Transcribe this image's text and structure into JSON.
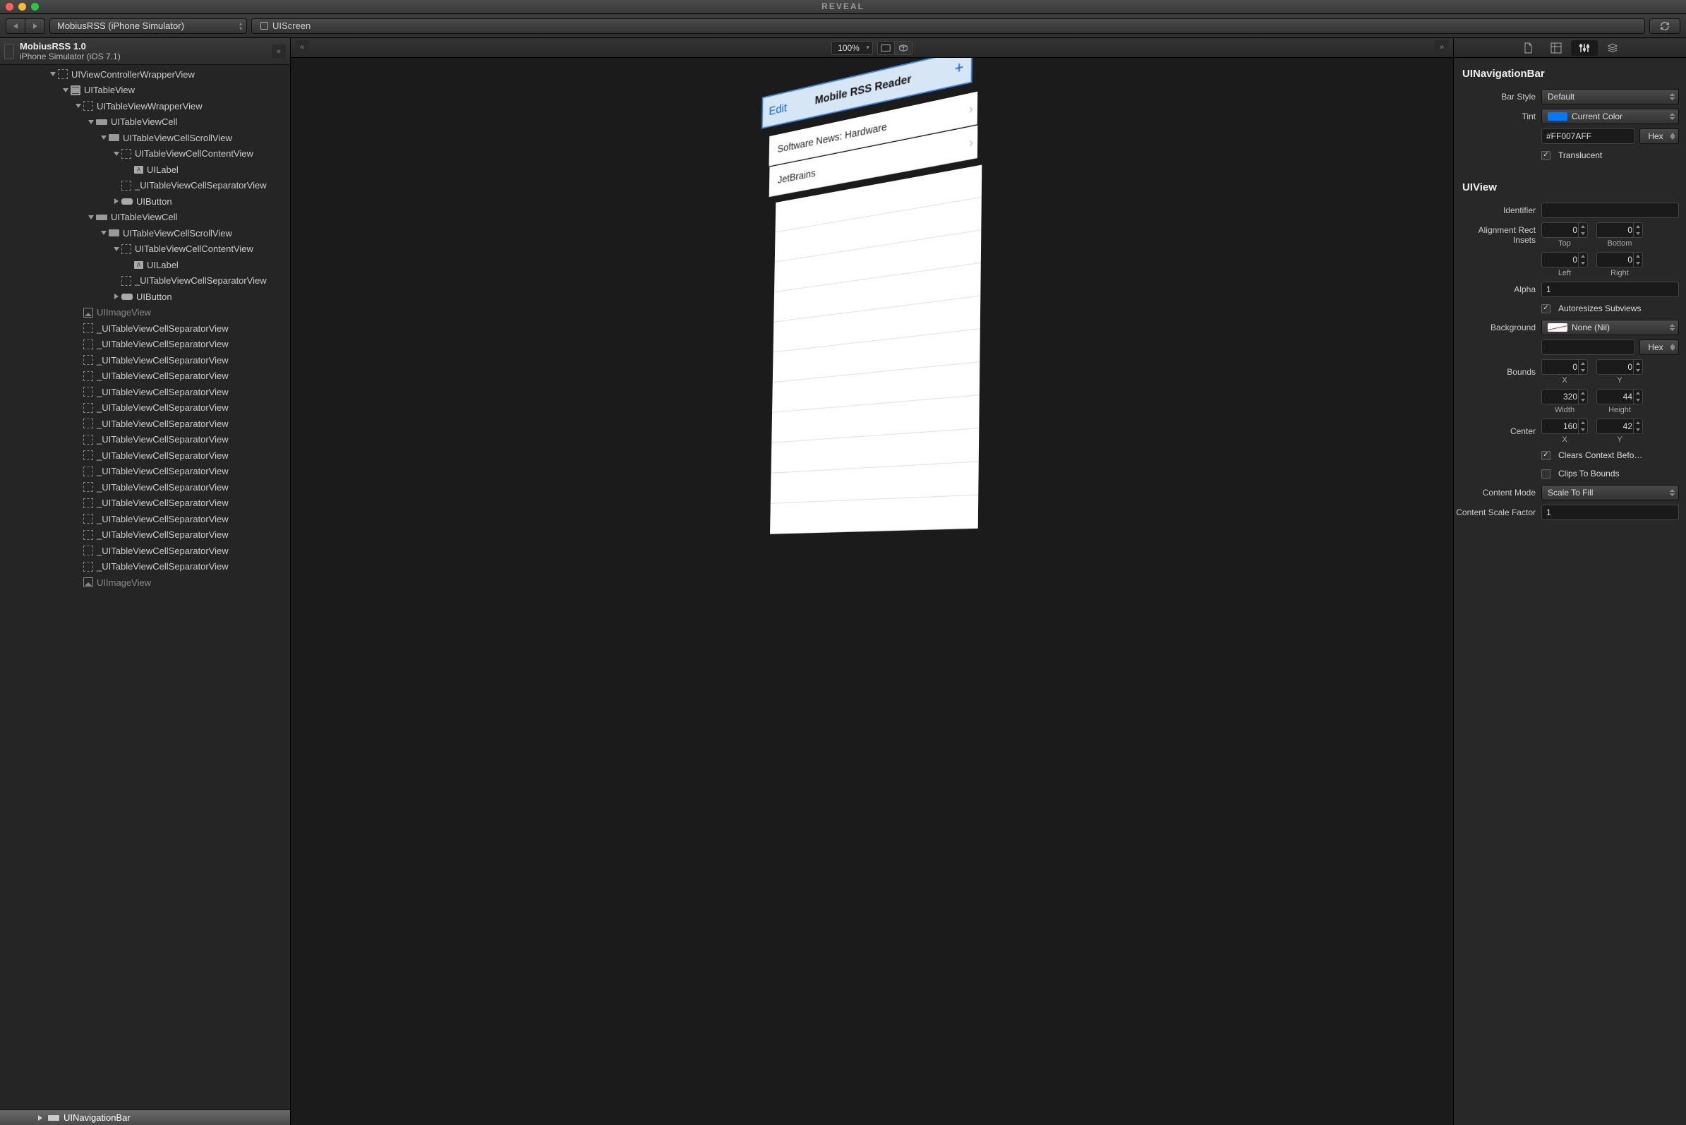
{
  "window": {
    "title": "REVEAL"
  },
  "toolbar": {
    "target_dropdown": "MobiusRSS (iPhone Simulator)",
    "breadcrumb": "UIScreen"
  },
  "sidebar": {
    "header": {
      "app_name": "MobiusRSS 1.0",
      "device": "iPhone Simulator (iOS 7.1)"
    },
    "tree": [
      {
        "depth": 4,
        "disc": "open",
        "icon": "dashed",
        "label": "UIViewControllerWrapperView",
        "dim": false
      },
      {
        "depth": 5,
        "disc": "open",
        "icon": "table",
        "label": "UITableView"
      },
      {
        "depth": 6,
        "disc": "open",
        "icon": "dashed",
        "label": "UITableViewWrapperView"
      },
      {
        "depth": 7,
        "disc": "open",
        "icon": "cell",
        "label": "UITableViewCell"
      },
      {
        "depth": 8,
        "disc": "open",
        "icon": "scroll",
        "label": "UITableViewCellScrollView"
      },
      {
        "depth": 9,
        "disc": "open",
        "icon": "dashed",
        "label": "UITableViewCellContentView"
      },
      {
        "depth": 10,
        "disc": "none",
        "icon": "label",
        "label": "UILabel"
      },
      {
        "depth": 9,
        "disc": "none",
        "icon": "dashed",
        "label": "_UITableViewCellSeparatorView"
      },
      {
        "depth": 9,
        "disc": "closed",
        "icon": "btn",
        "label": "UIButton"
      },
      {
        "depth": 7,
        "disc": "open",
        "icon": "cell",
        "label": "UITableViewCell"
      },
      {
        "depth": 8,
        "disc": "open",
        "icon": "scroll",
        "label": "UITableViewCellScrollView"
      },
      {
        "depth": 9,
        "disc": "open",
        "icon": "dashed",
        "label": "UITableViewCellContentView"
      },
      {
        "depth": 10,
        "disc": "none",
        "icon": "label",
        "label": "UILabel"
      },
      {
        "depth": 9,
        "disc": "none",
        "icon": "dashed",
        "label": "_UITableViewCellSeparatorView"
      },
      {
        "depth": 9,
        "disc": "closed",
        "icon": "btn",
        "label": "UIButton"
      },
      {
        "depth": 6,
        "disc": "none",
        "icon": "img",
        "label": "UIImageView",
        "dim": true
      },
      {
        "depth": 6,
        "disc": "none",
        "icon": "dashed",
        "label": "_UITableViewCellSeparatorView"
      },
      {
        "depth": 6,
        "disc": "none",
        "icon": "dashed",
        "label": "_UITableViewCellSeparatorView"
      },
      {
        "depth": 6,
        "disc": "none",
        "icon": "dashed",
        "label": "_UITableViewCellSeparatorView"
      },
      {
        "depth": 6,
        "disc": "none",
        "icon": "dashed",
        "label": "_UITableViewCellSeparatorView"
      },
      {
        "depth": 6,
        "disc": "none",
        "icon": "dashed",
        "label": "_UITableViewCellSeparatorView"
      },
      {
        "depth": 6,
        "disc": "none",
        "icon": "dashed",
        "label": "_UITableViewCellSeparatorView"
      },
      {
        "depth": 6,
        "disc": "none",
        "icon": "dashed",
        "label": "_UITableViewCellSeparatorView"
      },
      {
        "depth": 6,
        "disc": "none",
        "icon": "dashed",
        "label": "_UITableViewCellSeparatorView"
      },
      {
        "depth": 6,
        "disc": "none",
        "icon": "dashed",
        "label": "_UITableViewCellSeparatorView"
      },
      {
        "depth": 6,
        "disc": "none",
        "icon": "dashed",
        "label": "_UITableViewCellSeparatorView"
      },
      {
        "depth": 6,
        "disc": "none",
        "icon": "dashed",
        "label": "_UITableViewCellSeparatorView"
      },
      {
        "depth": 6,
        "disc": "none",
        "icon": "dashed",
        "label": "_UITableViewCellSeparatorView"
      },
      {
        "depth": 6,
        "disc": "none",
        "icon": "dashed",
        "label": "_UITableViewCellSeparatorView"
      },
      {
        "depth": 6,
        "disc": "none",
        "icon": "dashed",
        "label": "_UITableViewCellSeparatorView"
      },
      {
        "depth": 6,
        "disc": "none",
        "icon": "dashed",
        "label": "_UITableViewCellSeparatorView"
      },
      {
        "depth": 6,
        "disc": "none",
        "icon": "dashed",
        "label": "_UITableViewCellSeparatorView"
      },
      {
        "depth": 6,
        "disc": "none",
        "icon": "img",
        "label": "UIImageView",
        "dim": true
      }
    ],
    "footer": {
      "label": "UINavigationBar"
    }
  },
  "canvas": {
    "zoom": "100%",
    "preview": {
      "nav_left": "Edit",
      "nav_title": "Mobile RSS Reader",
      "nav_right": "+",
      "rows": [
        "Software News: Hardware",
        "JetBrains"
      ]
    }
  },
  "inspector": {
    "section1_title": "UINavigationBar",
    "bar_style_label": "Bar Style",
    "bar_style_value": "Default",
    "tint_label": "Tint",
    "tint_value": "Current Color",
    "tint_swatch": "#007AFF",
    "tint_hex": "#FF007AFF",
    "hex_label": "Hex",
    "translucent_label": "Translucent",
    "translucent_checked": true,
    "section2_title": "UIView",
    "identifier_label": "Identifier",
    "identifier_value": "",
    "insets_label": "Alignment Rect Insets",
    "insets": {
      "top": "0",
      "bottom": "0",
      "left": "0",
      "right": "0",
      "top_l": "Top",
      "bottom_l": "Bottom",
      "left_l": "Left",
      "right_l": "Right"
    },
    "alpha_label": "Alpha",
    "alpha_value": "1",
    "autoresize_label": "Autoresizes Subviews",
    "autoresize_checked": true,
    "background_label": "Background",
    "background_value": "None (Nil)",
    "bounds_label": "Bounds",
    "bounds": {
      "x": "0",
      "y": "0",
      "w": "320",
      "h": "44",
      "xl": "X",
      "yl": "Y",
      "wl": "Width",
      "hl": "Height"
    },
    "center_label": "Center",
    "center": {
      "x": "160",
      "y": "42",
      "xl": "X",
      "yl": "Y"
    },
    "clears_label": "Clears Context Befo…",
    "clears_checked": true,
    "clips_label": "Clips To Bounds",
    "clips_checked": false,
    "content_mode_label": "Content Mode",
    "content_mode_value": "Scale To Fill",
    "scale_factor_label": "Content Scale Factor",
    "scale_factor_value": "1"
  }
}
